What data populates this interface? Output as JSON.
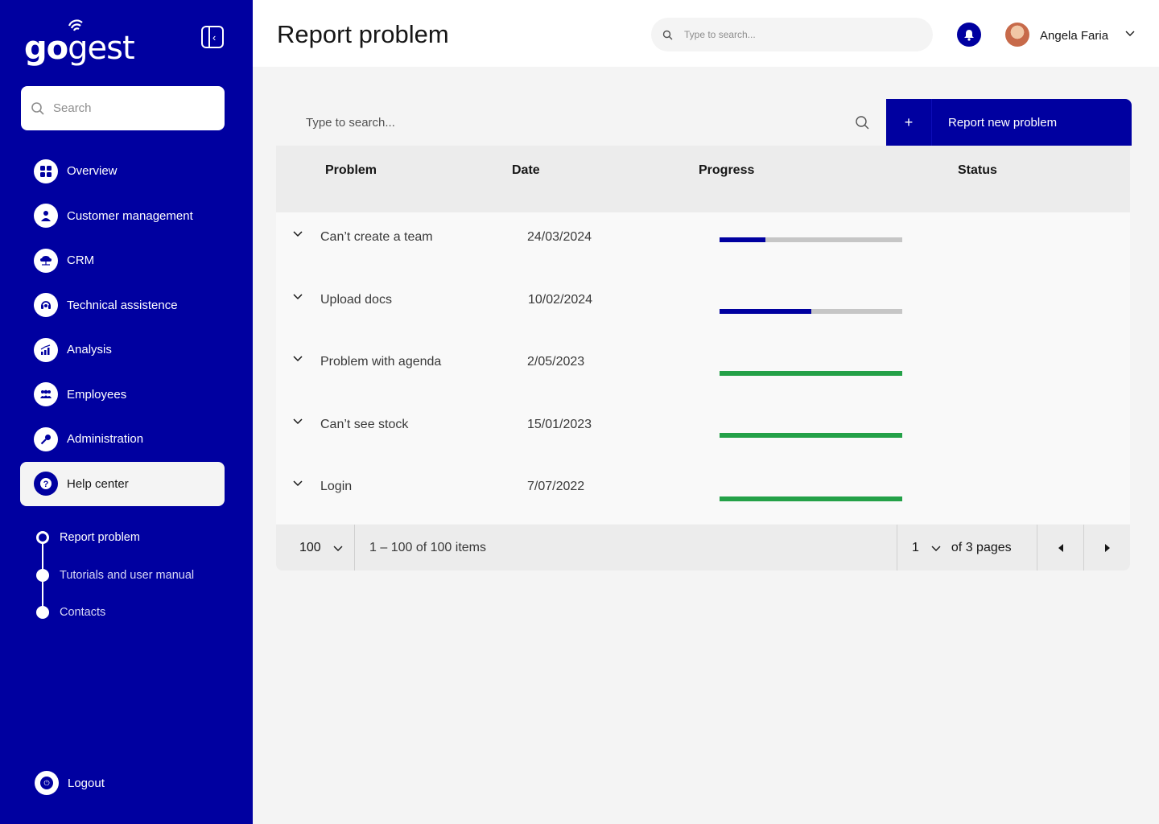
{
  "app": {
    "logo_bold": "go",
    "logo_light": "gest"
  },
  "sidebar": {
    "search_placeholder": "Search",
    "items": [
      {
        "label": "Overview",
        "icon": "grid-icon"
      },
      {
        "label": "Customer management",
        "icon": "user-icon"
      },
      {
        "label": "CRM",
        "icon": "cloud-network-icon"
      },
      {
        "label": "Technical assistence",
        "icon": "headset-icon"
      },
      {
        "label": "Analysis",
        "icon": "chart-icon"
      },
      {
        "label": "Employees",
        "icon": "group-icon"
      },
      {
        "label": "Administration",
        "icon": "key-icon"
      },
      {
        "label": "Help center",
        "icon": "help-icon",
        "active": true
      }
    ],
    "subitems": [
      {
        "label": "Report problem",
        "active": true
      },
      {
        "label": "Tutorials and user manual"
      },
      {
        "label": "Contacts"
      }
    ],
    "logout_label": "Logout"
  },
  "header": {
    "title": "Report problem",
    "search_placeholder": "Type to search...",
    "user_name": "Angela Faria"
  },
  "toolbar": {
    "search_placeholder": "Type to search...",
    "add_label": "Report new problem",
    "add_icon": "+"
  },
  "table": {
    "columns": [
      "Problem",
      "Date",
      "Progress",
      "Status"
    ],
    "rows": [
      {
        "problem": "Can’t create a team",
        "date": "24/03/2024",
        "progress": 0.25,
        "color": "#0000a0"
      },
      {
        "problem": "Upload docs",
        "date": "10/02/2024",
        "progress": 0.5,
        "color": "#0000a0"
      },
      {
        "problem": "Problem with agenda",
        "date": "2/05/2023",
        "progress": 1.0,
        "color": "#24a148"
      },
      {
        "problem": "Can’t see stock",
        "date": "15/01/2023",
        "progress": 1.0,
        "color": "#24a148"
      },
      {
        "problem": "Login",
        "date": "7/07/2022",
        "progress": 1.0,
        "color": "#24a148"
      }
    ]
  },
  "pagination": {
    "per_page": "100",
    "range": "1 – 100 of 100 items",
    "page": "1",
    "of_pages": "of 3 pages"
  },
  "colors": {
    "brand": "#0000a0",
    "success": "#24a148",
    "track": "#c6c6c6"
  }
}
